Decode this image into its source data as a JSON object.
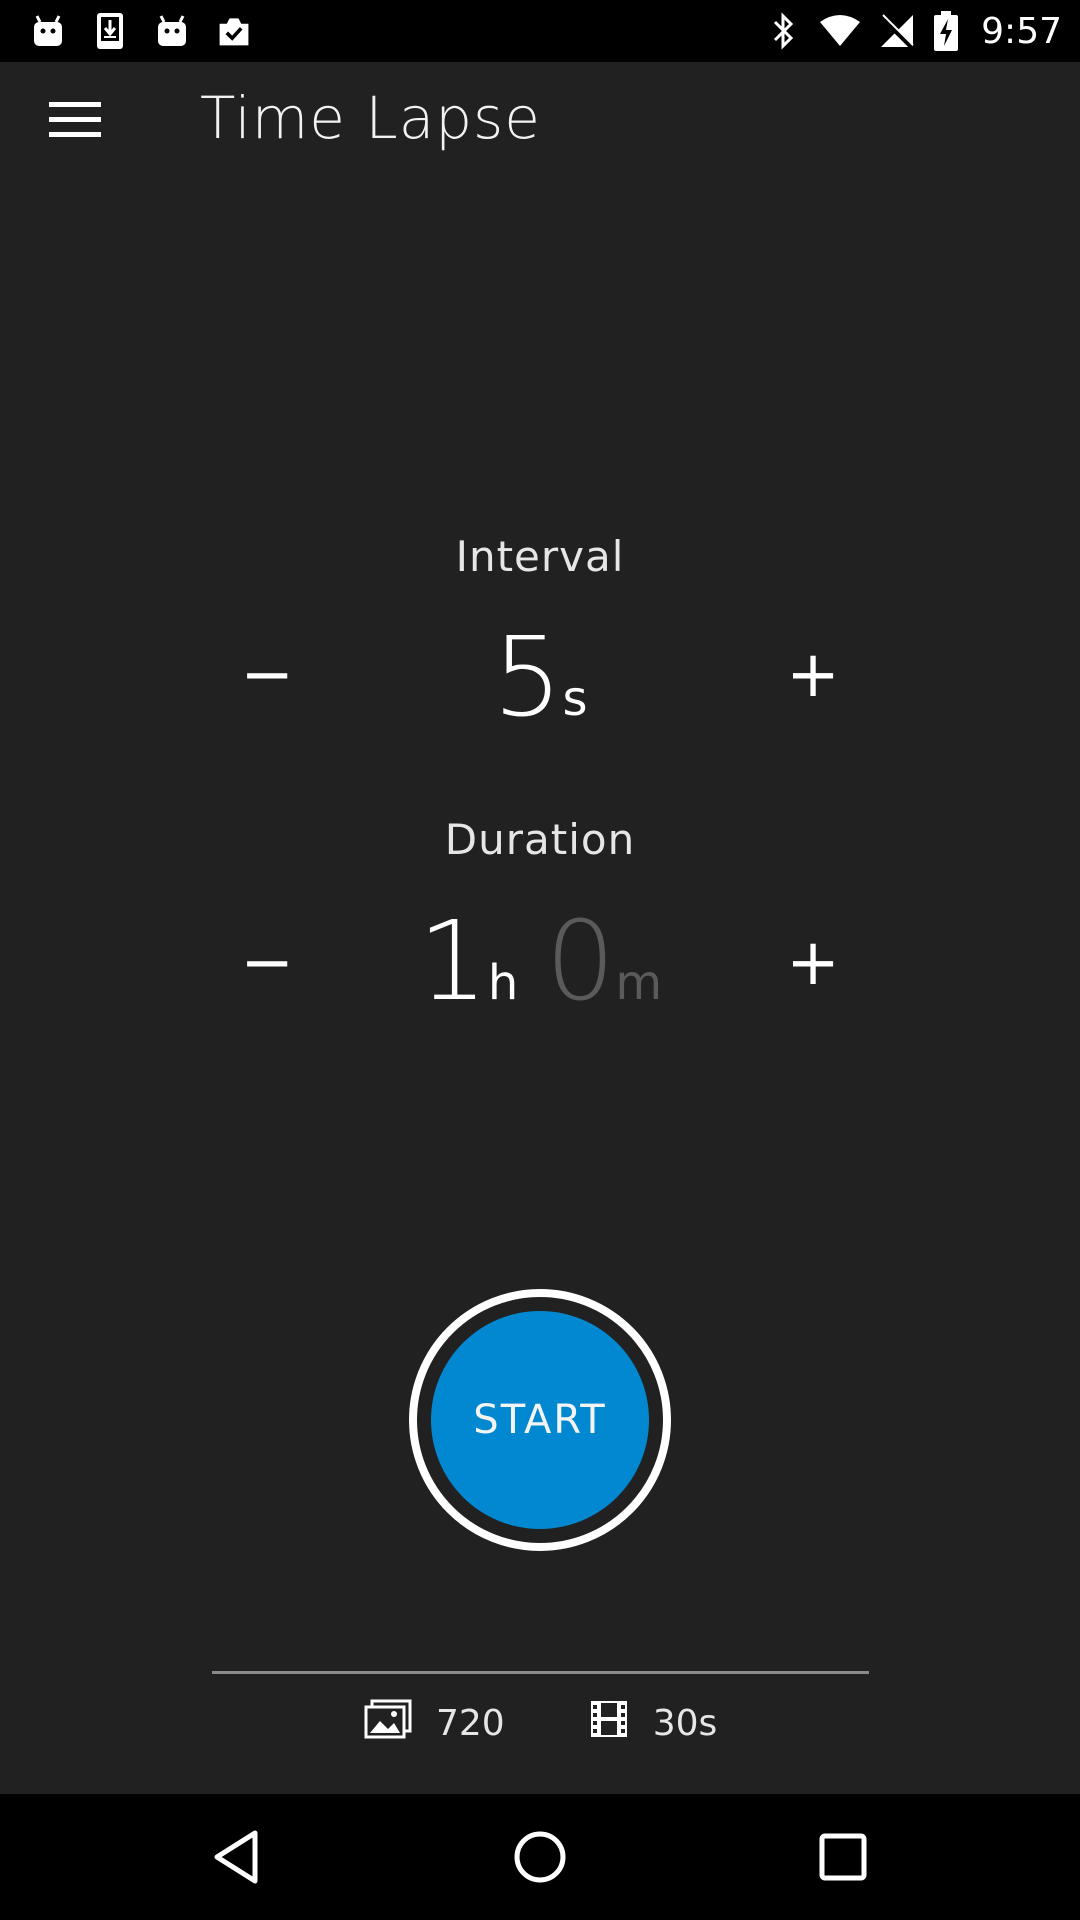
{
  "status_bar": {
    "time": "9:57",
    "left_icons": [
      "android-icon",
      "download-icon",
      "android-icon",
      "clipboard-check-icon"
    ],
    "right_icons": [
      "bluetooth-icon",
      "wifi-icon",
      "signal-off-icon",
      "battery-charging-icon"
    ]
  },
  "app_bar": {
    "title": "Time Lapse",
    "menu_icon": "hamburger-menu-icon"
  },
  "interval": {
    "label": "Interval",
    "value": "5",
    "unit": "s",
    "minus": "−",
    "plus": "+"
  },
  "duration": {
    "label": "Duration",
    "hours": "1",
    "hours_unit": "h",
    "minutes": "0",
    "minutes_unit": "m",
    "minus": "−",
    "plus": "+"
  },
  "start_button": {
    "label": "START",
    "color": "#0288d1"
  },
  "info": {
    "photos": "720",
    "photos_icon": "image-icon",
    "video_length": "30s",
    "video_icon": "film-icon"
  },
  "nav_bar": {
    "back_icon": "back-triangle-icon",
    "home_icon": "home-circle-icon",
    "recents_icon": "recents-square-icon"
  }
}
